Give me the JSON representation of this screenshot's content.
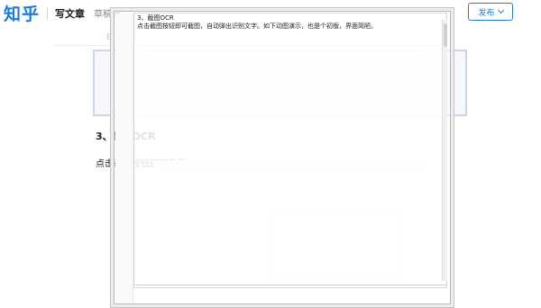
{
  "header": {
    "logo": "知乎",
    "title": "写文章",
    "drafts": "草稿自",
    "faded_right": "",
    "publish_label": "发布"
  },
  "editor": {
    "image_small_text": "",
    "heading": "3、截图OCR",
    "paragraph": "点击截图按钮即可截图"
  },
  "ocr_window": {
    "line1": "3、截图OCR",
    "line2": "点击截图按钮即可截图，自动弹出识别文字。如下动图演示，也是个初版，界面简陋。"
  },
  "colors": {
    "brand": "#1d7ae0"
  }
}
